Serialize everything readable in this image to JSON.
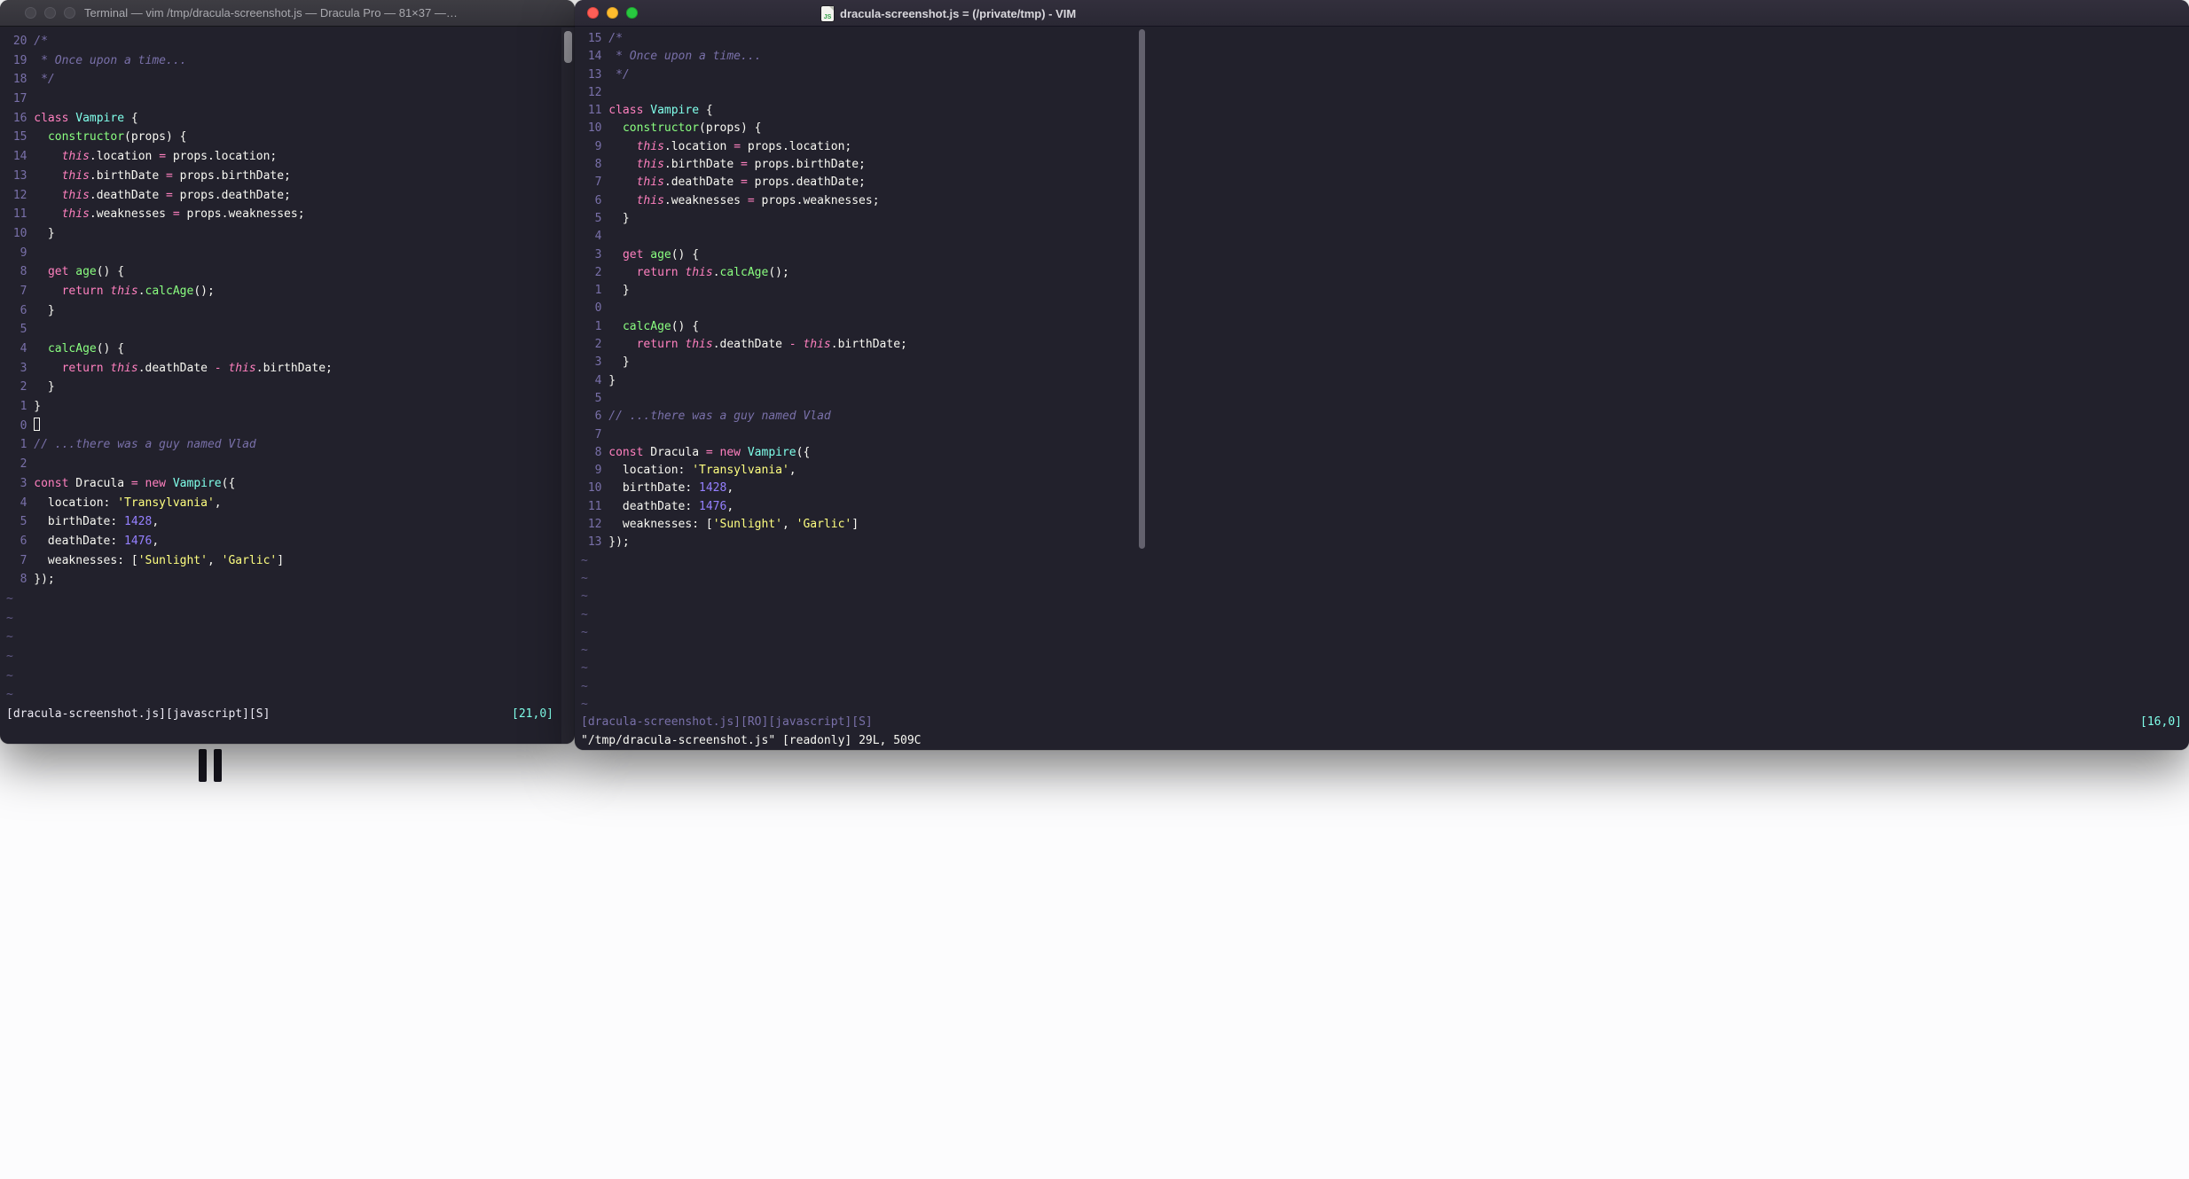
{
  "theme": {
    "bg": "#22212C",
    "fg": "#F8F8F2",
    "comment": "#7970A9",
    "pink": "#FF80BF",
    "green": "#8AFF80",
    "cyan": "#80FFEA",
    "purple": "#9580FF",
    "yellow": "#FFFF80"
  },
  "tilde": "~",
  "icons": {
    "proxy_document_icon": "js-file-page",
    "traffic_lights": [
      "close",
      "minimize",
      "zoom"
    ]
  },
  "file_lines": [
    [
      [
        "c",
        "/*"
      ]
    ],
    [
      [
        "c",
        " * Once upon a time..."
      ]
    ],
    [
      [
        "c",
        " */"
      ]
    ],
    [],
    [
      [
        "p",
        "class"
      ],
      [
        "w",
        " "
      ],
      [
        "cy",
        "Vampire"
      ],
      [
        "w",
        " {"
      ]
    ],
    [
      [
        "w",
        "  "
      ],
      [
        "g",
        "constructor"
      ],
      [
        "w",
        "(props) {"
      ]
    ],
    [
      [
        "w",
        "    "
      ],
      [
        "pi",
        "this"
      ],
      [
        "w",
        ".location "
      ],
      [
        "p",
        "="
      ],
      [
        "w",
        " props.location;"
      ]
    ],
    [
      [
        "w",
        "    "
      ],
      [
        "pi",
        "this"
      ],
      [
        "w",
        ".birthDate "
      ],
      [
        "p",
        "="
      ],
      [
        "w",
        " props.birthDate;"
      ]
    ],
    [
      [
        "w",
        "    "
      ],
      [
        "pi",
        "this"
      ],
      [
        "w",
        ".deathDate "
      ],
      [
        "p",
        "="
      ],
      [
        "w",
        " props.deathDate;"
      ]
    ],
    [
      [
        "w",
        "    "
      ],
      [
        "pi",
        "this"
      ],
      [
        "w",
        ".weaknesses "
      ],
      [
        "p",
        "="
      ],
      [
        "w",
        " props.weaknesses;"
      ]
    ],
    [
      [
        "w",
        "  }"
      ]
    ],
    [],
    [
      [
        "w",
        "  "
      ],
      [
        "p",
        "get"
      ],
      [
        "w",
        " "
      ],
      [
        "g",
        "age"
      ],
      [
        "w",
        "() {"
      ]
    ],
    [
      [
        "w",
        "    "
      ],
      [
        "p",
        "return"
      ],
      [
        "w",
        " "
      ],
      [
        "pi",
        "this"
      ],
      [
        "w",
        "."
      ],
      [
        "g",
        "calcAge"
      ],
      [
        "w",
        "();"
      ]
    ],
    [
      [
        "w",
        "  }"
      ]
    ],
    [],
    [
      [
        "w",
        "  "
      ],
      [
        "g",
        "calcAge"
      ],
      [
        "w",
        "() {"
      ]
    ],
    [
      [
        "w",
        "    "
      ],
      [
        "p",
        "return"
      ],
      [
        "w",
        " "
      ],
      [
        "pi",
        "this"
      ],
      [
        "w",
        ".deathDate "
      ],
      [
        "p",
        "-"
      ],
      [
        "w",
        " "
      ],
      [
        "pi",
        "this"
      ],
      [
        "w",
        ".birthDate;"
      ]
    ],
    [
      [
        "w",
        "  }"
      ]
    ],
    [
      [
        "w",
        "}"
      ]
    ],
    [],
    [
      [
        "c",
        "// ...there was a guy named Vlad"
      ]
    ],
    [],
    [
      [
        "p",
        "const"
      ],
      [
        "w",
        " Dracula "
      ],
      [
        "p",
        "="
      ],
      [
        "w",
        " "
      ],
      [
        "p",
        "new"
      ],
      [
        "w",
        " "
      ],
      [
        "cy",
        "Vampire"
      ],
      [
        "w",
        "({"
      ]
    ],
    [
      [
        "w",
        "  location: "
      ],
      [
        "y",
        "'Transylvania'"
      ],
      [
        "w",
        ","
      ]
    ],
    [
      [
        "w",
        "  birthDate: "
      ],
      [
        "pu",
        "1428"
      ],
      [
        "w",
        ","
      ]
    ],
    [
      [
        "w",
        "  deathDate: "
      ],
      [
        "pu",
        "1476"
      ],
      [
        "w",
        ","
      ]
    ],
    [
      [
        "w",
        "  weaknesses: ["
      ],
      [
        "y",
        "'Sunlight'"
      ],
      [
        "w",
        ", "
      ],
      [
        "y",
        "'Garlic'"
      ],
      [
        "w",
        "]"
      ]
    ],
    [
      [
        "w",
        "});"
      ]
    ]
  ],
  "left_window": {
    "title": "Terminal — vim /tmp/dracula-screenshot.js — Dracula Pro — 81×37 —…",
    "cursor_line": 21,
    "cursor": "hollow",
    "tilde_rows": 6,
    "status_left": "[dracula-screenshot.js][javascript][S]",
    "status_right": "[21,0]",
    "command_line": ""
  },
  "right_window": {
    "title": "dracula-screenshot.js = (/private/tmp) - VIM",
    "doc_icon_label": "JS",
    "cursor_line": 16,
    "cursor": "none",
    "tilde_rows": 9,
    "status_left": "[dracula-screenshot.js][RO][javascript][S]",
    "status_right": "[16,0]",
    "command_line": "\"/tmp/dracula-screenshot.js\" [readonly] 29L, 509C"
  }
}
